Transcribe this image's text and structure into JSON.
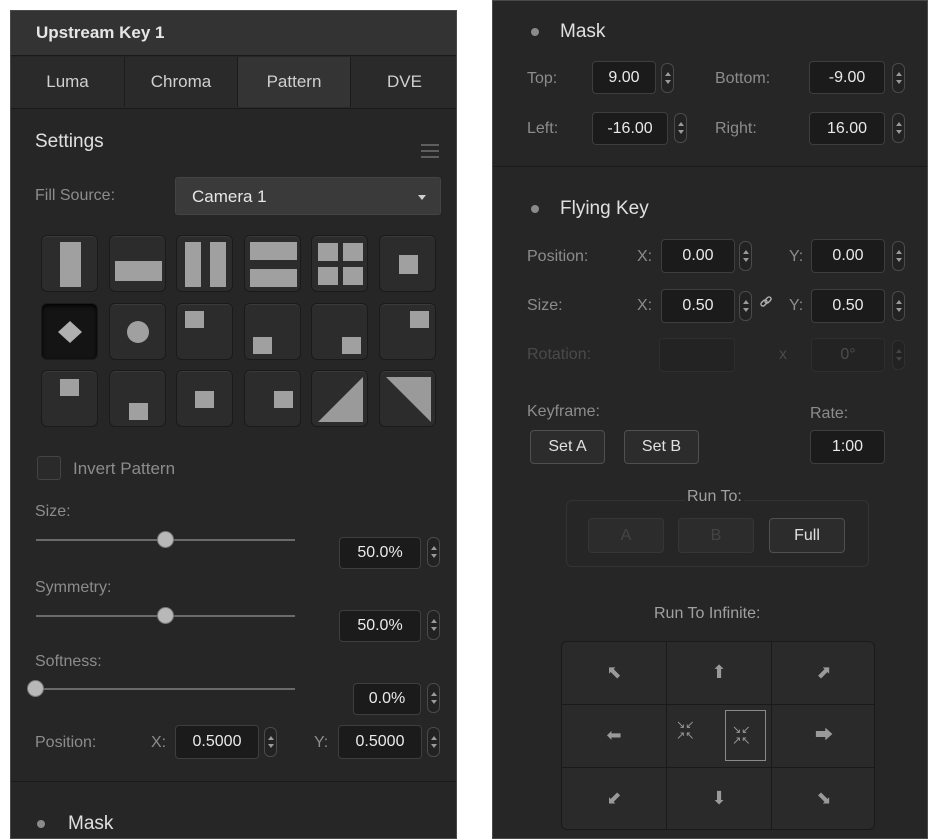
{
  "left": {
    "title": "Upstream Key 1",
    "tabs": [
      "Luma",
      "Chroma",
      "Pattern",
      "DVE"
    ],
    "active_tab": "Pattern",
    "settings_heading": "Settings",
    "fill_source_label": "Fill Source:",
    "fill_source_value": "Camera 1",
    "invert_pattern_label": "Invert Pattern",
    "invert_pattern_checked": false,
    "size_label": "Size:",
    "size_value": "50.0%",
    "size_level": 0.5,
    "symmetry_label": "Symmetry:",
    "symmetry_value": "50.0%",
    "symmetry_level": 0.5,
    "softness_label": "Softness:",
    "softness_value": "0.0%",
    "softness_level": 0.0,
    "position_label": "Position:",
    "x_label": "X:",
    "x_value": "0.5000",
    "y_label": "Y:",
    "y_value": "0.5000",
    "mask_heading": "Mask",
    "patterns": [
      "vertical-bar",
      "horizontal-bar",
      "vertical-barn-door",
      "horizontal-barn-door",
      "four-box",
      "center-box",
      "diamond",
      "circle",
      "top-left-box",
      "bottom-left-box",
      "bottom-right-box",
      "top-right-box",
      "top-left-inner-box",
      "bottom-center-box",
      "center-box-left",
      "center-box-right",
      "diagonal-top-right",
      "diagonal-top-left"
    ],
    "selected_pattern": "diamond"
  },
  "right": {
    "mask_heading": "Mask",
    "top_label": "Top:",
    "top_value": "9.00",
    "bottom_label": "Bottom:",
    "bottom_value": "-9.00",
    "left_label": "Left:",
    "left_value": "-16.00",
    "right_label": "Right:",
    "right_value": "16.00",
    "flying_key_heading": "Flying Key",
    "position_label": "Position:",
    "pos_x_label": "X:",
    "pos_x_value": "0.00",
    "pos_y_label": "Y:",
    "pos_y_value": "0.00",
    "size_label": "Size:",
    "size_x_label": "X:",
    "size_x_value": "0.50",
    "size_y_label": "Y:",
    "size_y_value": "0.50",
    "rotation_label": "Rotation:",
    "rotation_x_label": "x",
    "rotation_value": "0°",
    "keyframe_label": "Keyframe:",
    "set_a_label": "Set A",
    "set_b_label": "Set B",
    "rate_label": "Rate:",
    "rate_value": "1:00",
    "run_to_label": "Run To:",
    "run_to_buttons": [
      "A",
      "B",
      "Full"
    ],
    "run_to_infinite_label": "Run To Infinite:",
    "infinite_icons": [
      "arrow-up-left-icon",
      "arrow-up-icon",
      "arrow-up-right-icon",
      "arrow-left-icon",
      "zoom-in-icon",
      "zoom-out-icon",
      "arrow-right-icon",
      "arrow-down-left-icon",
      "arrow-down-icon",
      "arrow-down-right-icon"
    ]
  }
}
